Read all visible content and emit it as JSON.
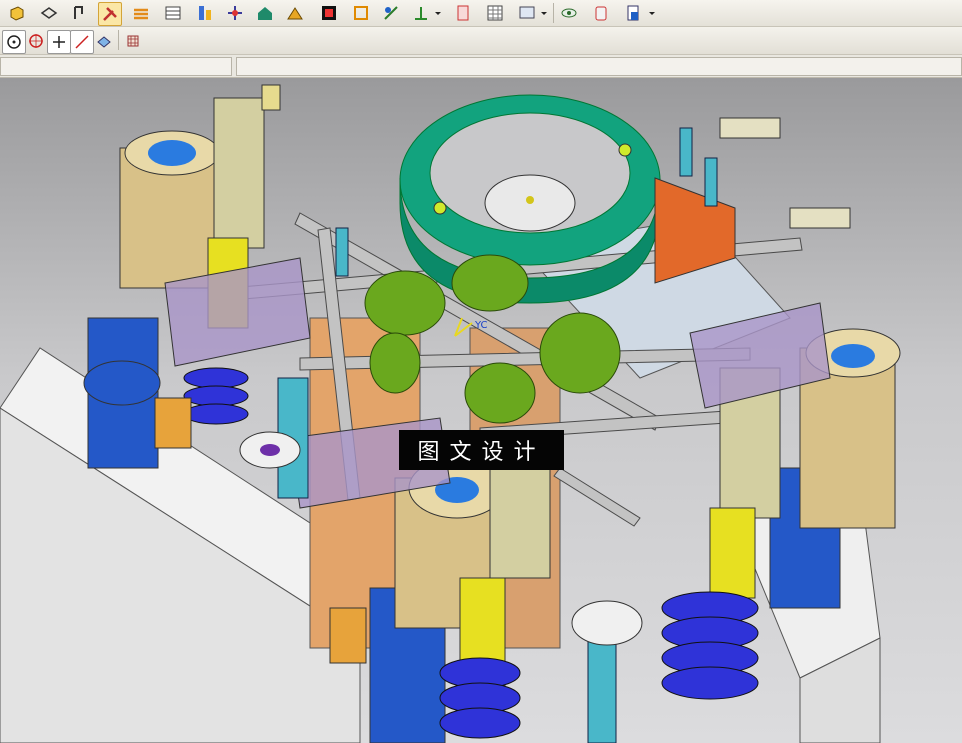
{
  "toolbar_main": {
    "icons": [
      "part-icon",
      "sketch-icon",
      "extrude-icon",
      "tools-icon",
      "layers-icon",
      "table-icon",
      "assembly-icon",
      "constraint-icon",
      "home-icon",
      "measure-icon",
      "section-icon",
      "move-icon",
      "datum-icon",
      "analysis-icon",
      "wave-icon",
      "grid-icon",
      "display-icon",
      "eye-icon",
      "bin-icon",
      "document-icon"
    ]
  },
  "toolbar_snap": {
    "icons": [
      "center-point-icon",
      "circle-snap-icon",
      "cross-snap-icon",
      "line-snap-icon",
      "view-icon",
      "filter-grid-icon"
    ]
  },
  "viewport": {
    "triad_label": "YC",
    "watermark": "图文设计"
  },
  "colors": {
    "background_top": "#9a9a9c",
    "background_bottom": "#dcdcde",
    "ring_green": "#12a37e",
    "spring_blue": "#2f33d8",
    "post_tan": "#d9c38a",
    "post_blue": "#1f58c7",
    "base_gray": "#ececec"
  }
}
